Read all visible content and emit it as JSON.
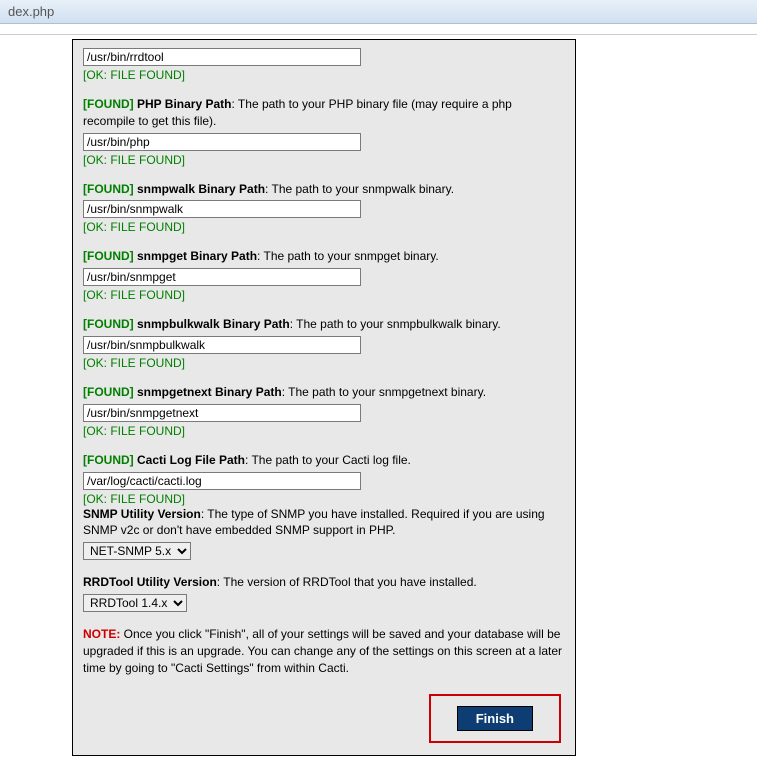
{
  "window": {
    "title_fragment": "dex.php"
  },
  "fields": [
    {
      "tag": "",
      "label": "",
      "desc": "",
      "value": "/usr/bin/rrdtool",
      "ok": "[OK: FILE FOUND]",
      "show_header": false
    },
    {
      "tag": "[FOUND]",
      "label": "PHP Binary Path",
      "desc": ": The path to your PHP binary file (may require a php recompile to get this file).",
      "value": "/usr/bin/php",
      "ok": "[OK: FILE FOUND]",
      "show_header": true
    },
    {
      "tag": "[FOUND]",
      "label": "snmpwalk Binary Path",
      "desc": ": The path to your snmpwalk binary.",
      "value": "/usr/bin/snmpwalk",
      "ok": "[OK: FILE FOUND]",
      "show_header": true
    },
    {
      "tag": "[FOUND]",
      "label": "snmpget Binary Path",
      "desc": ": The path to your snmpget binary.",
      "value": "/usr/bin/snmpget",
      "ok": "[OK: FILE FOUND]",
      "show_header": true
    },
    {
      "tag": "[FOUND]",
      "label": "snmpbulkwalk Binary Path",
      "desc": ": The path to your snmpbulkwalk binary.",
      "value": "/usr/bin/snmpbulkwalk",
      "ok": "[OK: FILE FOUND]",
      "show_header": true
    },
    {
      "tag": "[FOUND]",
      "label": "snmpgetnext Binary Path",
      "desc": ": The path to your snmpgetnext binary.",
      "value": "/usr/bin/snmpgetnext",
      "ok": "[OK: FILE FOUND]",
      "show_header": true
    },
    {
      "tag": "[FOUND]",
      "label": "Cacti Log File Path",
      "desc": ": The path to your Cacti log file.",
      "value": "/var/log/cacti/cacti.log",
      "ok": "[OK: FILE FOUND]",
      "show_header": true
    }
  ],
  "snmp_version": {
    "label": "SNMP Utility Version",
    "desc": ": The type of SNMP you have installed. Required if you are using SNMP v2c or don't have embedded SNMP support in PHP.",
    "selected": "NET-SNMP 5.x"
  },
  "rrd_version": {
    "label": "RRDTool Utility Version",
    "desc": ": The version of RRDTool that you have installed.",
    "selected": "RRDTool 1.4.x"
  },
  "note": {
    "tag": "NOTE:",
    "text": " Once you click \"Finish\", all of your settings will be saved and your database will be upgraded if this is an upgrade. You can change any of the settings on this screen at a later time by going to \"Cacti Settings\" from within Cacti."
  },
  "buttons": {
    "finish": "Finish"
  }
}
